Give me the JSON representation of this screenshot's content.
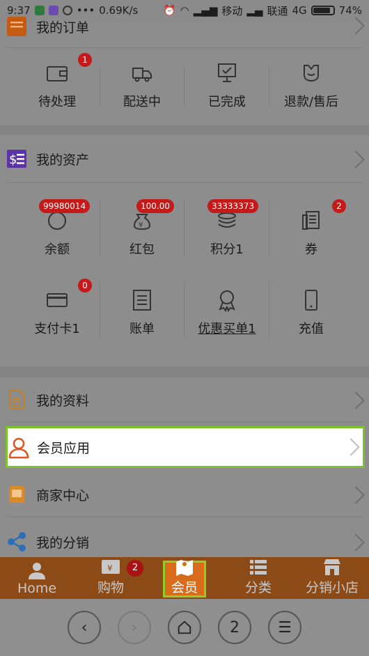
{
  "status_bar": {
    "time": "9:37",
    "network_speed": "0.69K/s",
    "carrier1": "移动",
    "carrier2": "联通",
    "network_type": "4G",
    "battery": "74%"
  },
  "orders": {
    "title": "我的订单",
    "items": [
      {
        "label": "待处理",
        "badge": "1",
        "icon": "wallet-icon"
      },
      {
        "label": "配送中",
        "icon": "truck-icon"
      },
      {
        "label": "已完成",
        "icon": "check-display-icon"
      },
      {
        "label": "退款/售后",
        "icon": "service-icon"
      }
    ]
  },
  "assets": {
    "title": "我的资产",
    "items": [
      {
        "label": "余额",
        "badge": "99980014",
        "icon": "balance-icon"
      },
      {
        "label": "红包",
        "badge": "100.00",
        "icon": "red-packet-icon"
      },
      {
        "label": "积分1",
        "badge": "33333373",
        "icon": "points-icon"
      },
      {
        "label": "券",
        "badge": "2",
        "icon": "coupon-icon"
      },
      {
        "label": "支付卡1",
        "badge": "0",
        "icon": "card-icon"
      },
      {
        "label": "账单",
        "icon": "bill-icon"
      },
      {
        "label": "优惠买单1",
        "icon": "award-icon"
      },
      {
        "label": "充值",
        "icon": "phone-icon"
      }
    ]
  },
  "menu": {
    "profile": "我的资料",
    "member_apps": "会员应用",
    "merchant_center": "商家中心",
    "distribution": "我的分销"
  },
  "tabbar": {
    "home": "Home",
    "cart": "购物",
    "cart_badge": "2",
    "member": "会员",
    "category": "分类",
    "shop": "分销小店"
  },
  "browser": {
    "tabs_count": "2"
  }
}
